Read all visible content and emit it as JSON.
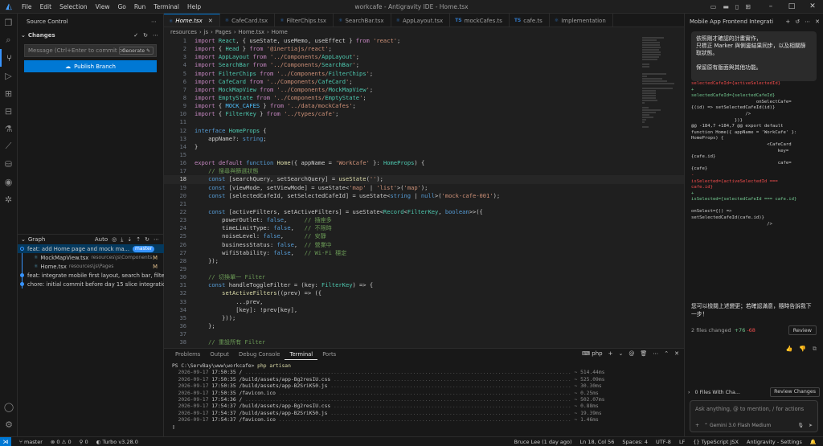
{
  "window": {
    "title": "workcafe - Antigravity IDE - Home.tsx",
    "menu": [
      "File",
      "Edit",
      "Selection",
      "View",
      "Go",
      "Run",
      "Terminal",
      "Help"
    ]
  },
  "sidebar": {
    "header": "Source Control",
    "changes_label": "Changes",
    "commit_placeholder": "Message (Ctrl+Enter to commit on...",
    "generate_label": "Generate",
    "publish_label": "Publish Branch",
    "graph_label": "Graph",
    "graph_auto": "Auto",
    "graph": [
      {
        "message": "feat: add Home page and mock ma...",
        "badge": "master",
        "selected": true
      },
      {
        "file": "MockMapView.tsx",
        "path": "resources\\js\\Components",
        "status": "M"
      },
      {
        "file": "Home.tsx",
        "path": "resources\\js\\Pages",
        "status": "M"
      },
      {
        "message": "feat: integrate mobile first layout, search bar, filter ..."
      },
      {
        "message": "chore: initial commit before day 15 slice integration"
      }
    ]
  },
  "tabs": [
    {
      "label": "Home.tsx",
      "active": true
    },
    {
      "label": "CafeCard.tsx"
    },
    {
      "label": "FilterChips.tsx"
    },
    {
      "label": "SearchBar.tsx"
    },
    {
      "label": "AppLayout.tsx"
    },
    {
      "label": "mockCafes.ts"
    },
    {
      "label": "cafe.ts"
    },
    {
      "label": "Implementation"
    }
  ],
  "breadcrumb": [
    "resources",
    "js",
    "Pages",
    "Home.tsx",
    "Home"
  ],
  "code_lines": [
    "import React, { useState, useMemo, useEffect } from 'react';",
    "import { Head } from '@inertiajs/react';",
    "import AppLayout from '../Components/AppLayout';",
    "import SearchBar from '../Components/SearchBar';",
    "import FilterChips from '../Components/FilterChips';",
    "import CafeCard from '../Components/CafeCard';",
    "import MockMapView from '../Components/MockMapView';",
    "import EmptyState from '../Components/EmptyState';",
    "import { MOCK_CAFES } from '../data/mockCafes';",
    "import { FilterKey } from '../types/cafe';",
    "",
    "interface HomeProps {",
    "    appName?: string;",
    "}",
    "",
    "export default function Home({ appName = 'WorkCafe' }: HomeProps) {",
    "    // 搜尋與篩選狀態",
    "    const [searchQuery, setSearchQuery] = useState('');",
    "    const [viewMode, setViewMode] = useState<'map' | 'list'>('map');",
    "    const [selectedCafeId, setSelectedCafeId] = useState<string | null>('mock-cafe-001');",
    "",
    "    const [activeFilters, setActiveFilters] = useState<Record<FilterKey, boolean>>({",
    "        powerOutlet: false,     // 插座多",
    "        timeLimitType: false,   // 不限時",
    "        noiseLevel: false,      // 安靜",
    "        businessStatus: false,  // 營業中",
    "        wifiStability: false,   // Wi-Fi 穩定",
    "    });",
    "",
    "    // 切換單一 Filter",
    "    const handleToggleFilter = (key: FilterKey) => {",
    "        setActiveFilters((prev) => ({",
    "            ...prev,",
    "            [key]: !prev[key],",
    "        }));",
    "    };",
    "",
    "    // 重設所有 Filter"
  ],
  "current_line": 18,
  "panel": {
    "tabs": [
      "Problems",
      "Output",
      "Debug Console",
      "Terminal",
      "Ports"
    ],
    "active_tab": "Terminal",
    "shell": "php",
    "prompt": "PS C:\\ServBay\\www\\workcafe>",
    "command": "php artisan",
    "log": [
      {
        "date": "2026-09-17",
        "time": "17:50:35",
        "path": "/",
        "ms": "~ 514.44ms"
      },
      {
        "date": "2026-09-17",
        "time": "17:50:35",
        "path": "/build/assets/app-Bg2resIU.css",
        "ms": "~ 525.09ms"
      },
      {
        "date": "2026-09-17",
        "time": "17:50:35",
        "path": "/build/assets/app-B2SriK50.js",
        "ms": "~ 30.30ms"
      },
      {
        "date": "2026-09-17",
        "time": "17:50:35",
        "path": "/favicon.ico",
        "ms": "~ 0.25ms"
      },
      {
        "date": "2026-09-17",
        "time": "17:54:36",
        "path": "/",
        "ms": "~ 502.07ms"
      },
      {
        "date": "2026-09-17",
        "time": "17:54:37",
        "path": "/build/assets/app-Bg2resIU.css",
        "ms": "~ 0.88ms"
      },
      {
        "date": "2026-09-17",
        "time": "17:54:37",
        "path": "/build/assets/app-B2SriK50.js",
        "ms": "~ 19.39ms"
      },
      {
        "date": "2026-09-17",
        "time": "17:54:37",
        "path": "/favicon.ico",
        "ms": "~ 1.46ms"
      }
    ]
  },
  "chat": {
    "title": "Mobile App Frontend Integrati",
    "bubble_lines": [
      "依照剛才確認的計畫實作，",
      "只標正 Marker 與側邊結果同步，以及相關篩",
      "取狀態。",
      "",
      "保留原有版面與其他功能。"
    ],
    "diff_lines": [
      {
        "t": "selectedCafeId={activeSelectedId}",
        "c": "r"
      },
      {
        "t": "+",
        "c": "g"
      },
      {
        "t": "selectedCafeId={selectedCafeId}",
        "c": "g"
      },
      {
        "t": "                        onSelectCafe=",
        "c": ""
      },
      {
        "t": "{(id) => setSelectedCafeId(id)}",
        "c": ""
      },
      {
        "t": "                    />",
        "c": ""
      },
      {
        "t": "                })}",
        "c": ""
      },
      {
        "t": "@@ -184,7 +184,7 @@ export default",
        "c": ""
      },
      {
        "t": "function Home({ appName = 'WorkCafe' }:",
        "c": ""
      },
      {
        "t": "HomeProps) {",
        "c": ""
      },
      {
        "t": "                            <CafeCard",
        "c": ""
      },
      {
        "t": "                                key=",
        "c": ""
      },
      {
        "t": "{cafe.id}",
        "c": ""
      },
      {
        "t": "                                cafe=",
        "c": ""
      },
      {
        "t": "{cafe}",
        "c": ""
      },
      {
        "t": "-",
        "c": "r"
      },
      {
        "t": "isSelected={activeSelectedId ===",
        "c": "r"
      },
      {
        "t": "cafe.id}",
        "c": "r"
      },
      {
        "t": "+",
        "c": "g"
      },
      {
        "t": "isSelected={selectedCafeId === cafe.id}",
        "c": "g"
      },
      {
        "t": "",
        "c": ""
      },
      {
        "t": "onSelect={() =>",
        "c": ""
      },
      {
        "t": "setSelectedCafeId(cafe.id)}",
        "c": ""
      },
      {
        "t": "                            />",
        "c": ""
      }
    ],
    "message": "您可以檢閱上述變更；若確認滿意，隨時告訴我下一步！",
    "files_changed": "2 files changed",
    "additions": "+76",
    "deletions": "-68",
    "review_label": "Review",
    "files_with_changes": "0 Files With Cha...",
    "review_changes": "Review Changes",
    "input_placeholder": "Ask anything, @ to mention, / for actions",
    "model": "Gemini 3.0 Flash Medium"
  },
  "status": {
    "branch": "master",
    "errors": "0",
    "warnings": "0",
    "ports": "0",
    "turbo": "Turbo v3.28.0",
    "blame": "Bruce Lee (1 day ago)",
    "position": "Ln 18, Col 56",
    "spaces": "Spaces: 4",
    "encoding": "UTF-8",
    "eol": "LF",
    "language": "TypeScript JSX",
    "app": "Antigravity - Settings"
  }
}
